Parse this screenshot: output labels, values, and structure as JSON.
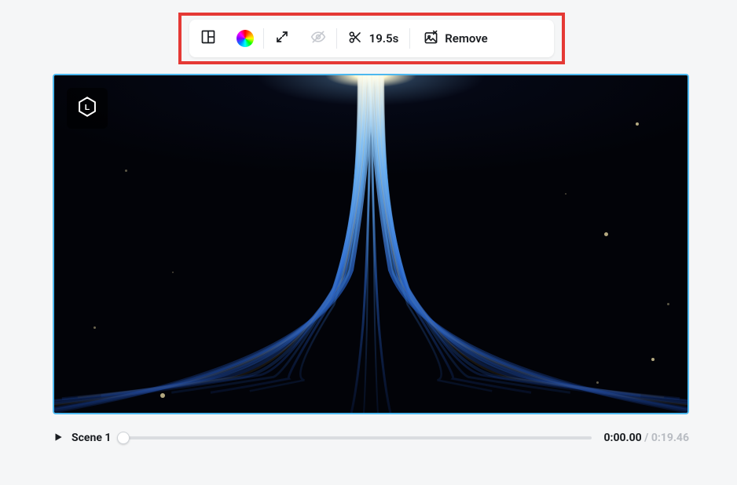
{
  "toolbar": {
    "trim_duration": "19.5s",
    "remove_label": "Remove"
  },
  "player": {
    "scene_label": "Scene 1",
    "time_current": "0:00.00",
    "time_separator": " / ",
    "time_total": "0:19.46"
  }
}
